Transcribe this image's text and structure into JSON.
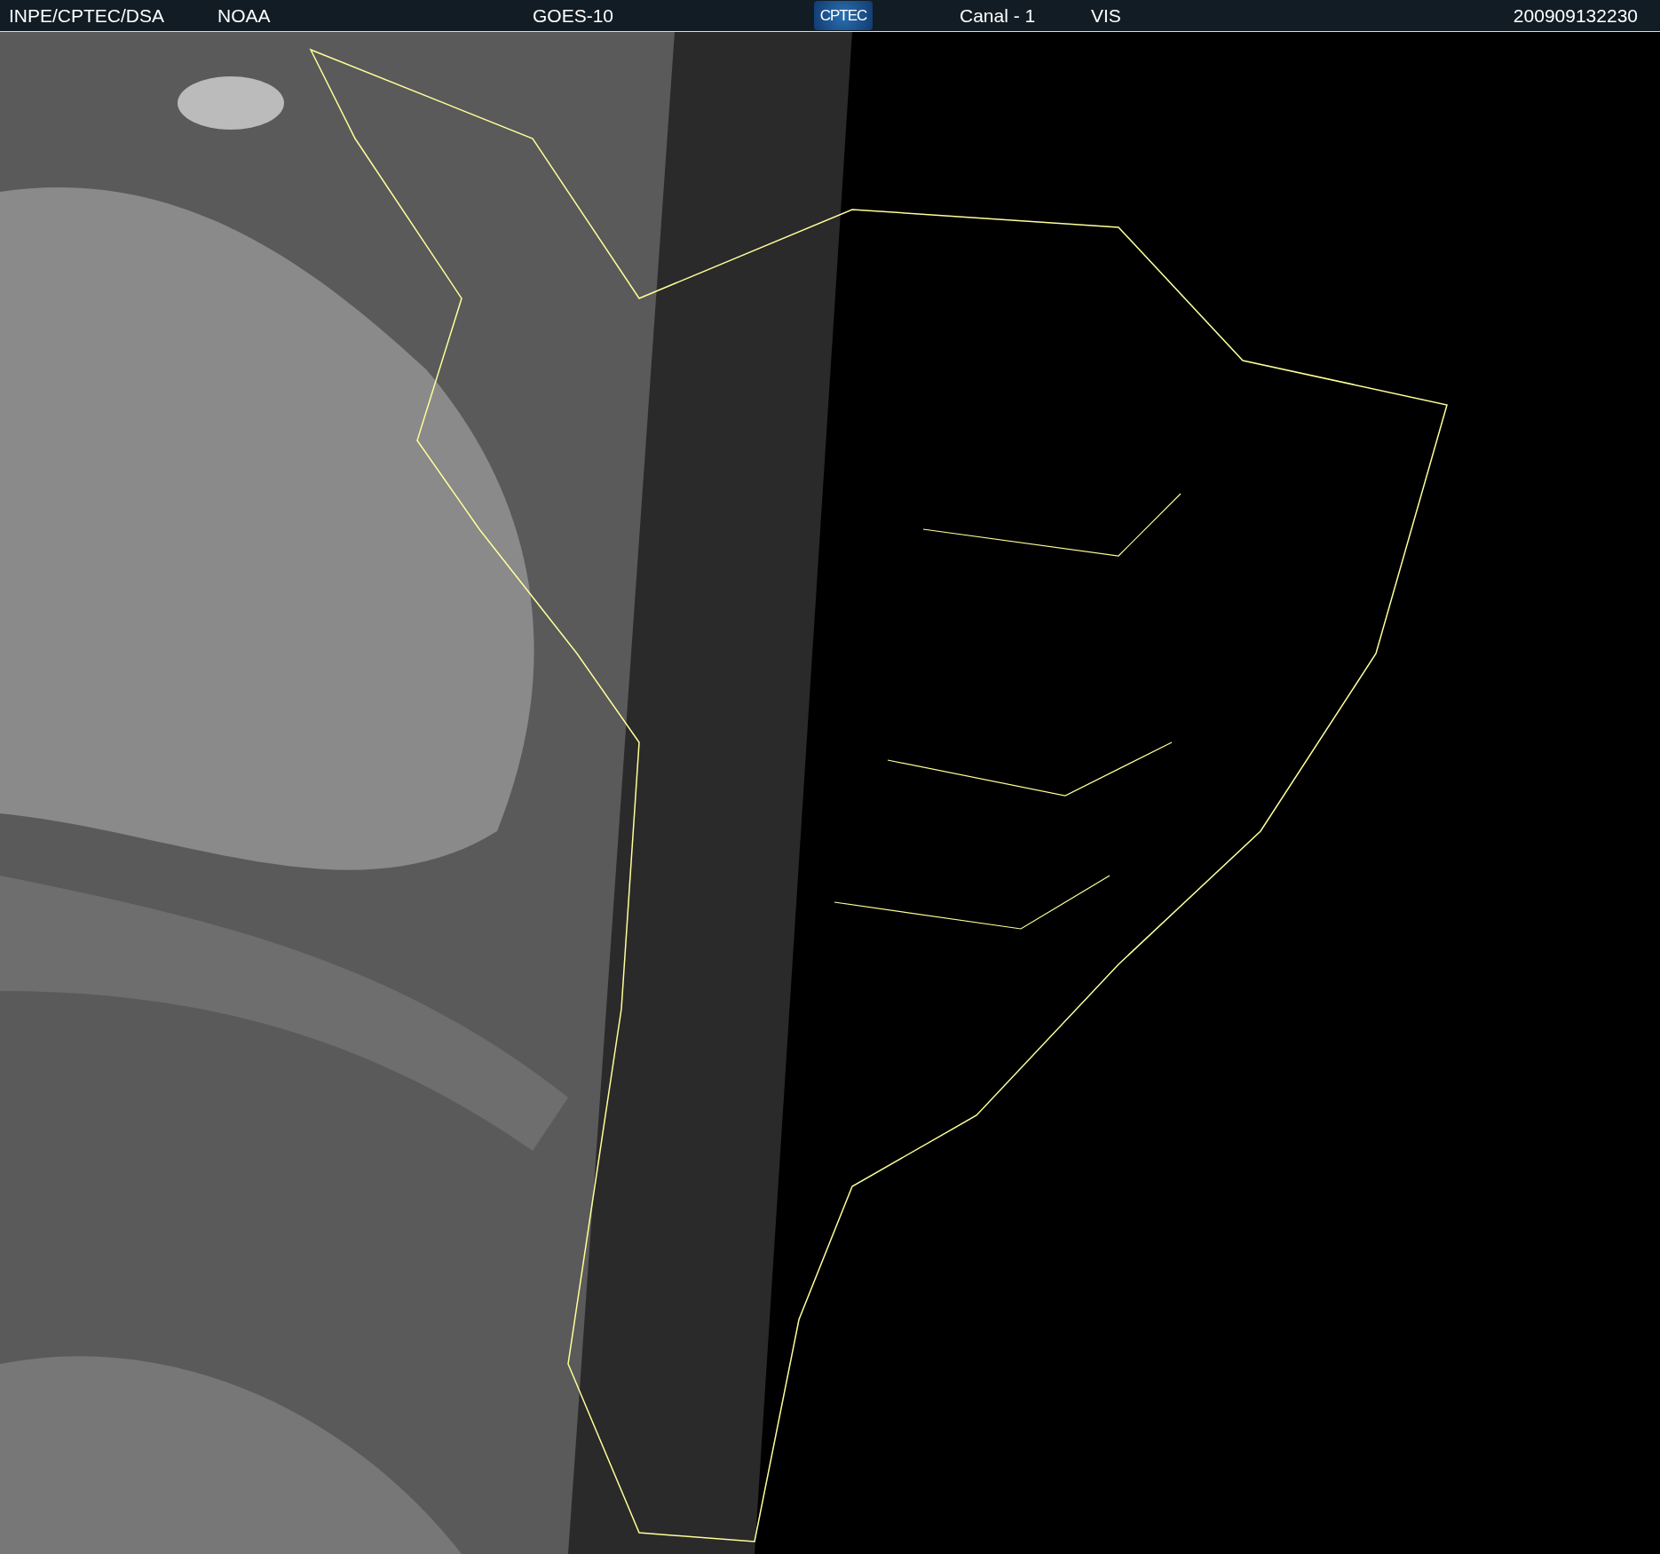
{
  "header": {
    "source": "INPE/CPTEC/DSA",
    "agency": "NOAA",
    "satellite": "GOES-10",
    "logo_text": "CPTEC",
    "channel": "Canal - 1",
    "band": "VIS",
    "timestamp": "200909132230"
  }
}
